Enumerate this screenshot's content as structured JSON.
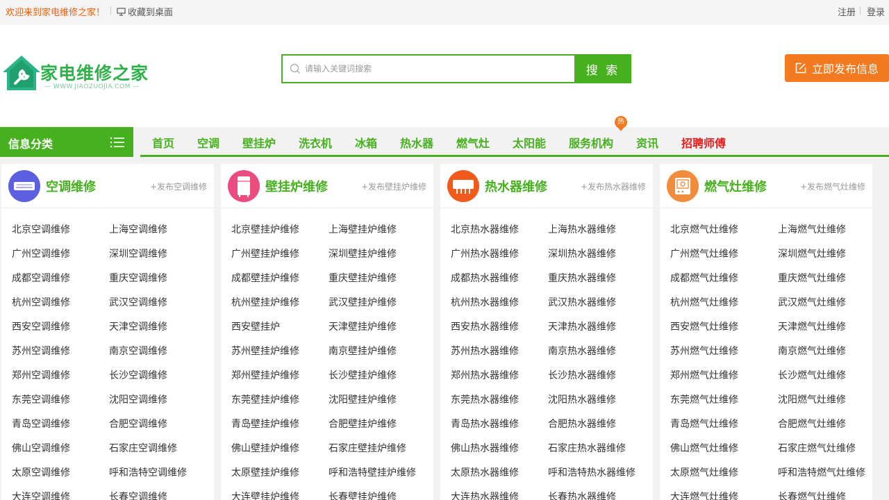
{
  "topbar": {
    "welcome": "欢迎来到家电维修之家！",
    "favorite": "收藏到桌面",
    "register": "注册",
    "login": "登录"
  },
  "logo": {
    "name": "家电维修之家",
    "url": "— WWW.JIAOZUOJIA.COM —"
  },
  "search": {
    "placeholder": "请输入关键词搜索",
    "button": "搜 索"
  },
  "publish_button": "立即发布信息",
  "nav": {
    "category_label": "信息分类",
    "hot_badge": "热",
    "items": [
      {
        "label": "首页"
      },
      {
        "label": "空调"
      },
      {
        "label": "壁挂炉"
      },
      {
        "label": "洗衣机"
      },
      {
        "label": "冰箱"
      },
      {
        "label": "热水器"
      },
      {
        "label": "燃气灶"
      },
      {
        "label": "太阳能"
      },
      {
        "label": "服务机构"
      },
      {
        "label": "资讯"
      },
      {
        "label": "招聘师傅"
      }
    ]
  },
  "cards": [
    {
      "title": "空调维修",
      "publish_link": "+发布空调维修",
      "icon": "air-conditioner-icon",
      "icon_color": "#5b5fe0",
      "links": [
        "北京空调维修",
        "上海空调维修",
        "广州空调维修",
        "深圳空调维修",
        "成都空调维修",
        "重庆空调维修",
        "杭州空调维修",
        "武汉空调维修",
        "西安空调维修",
        "天津空调维修",
        "苏州空调维修",
        "南京空调维修",
        "郑州空调维修",
        "长沙空调维修",
        "东莞空调维修",
        "沈阳空调维修",
        "青岛空调维修",
        "合肥空调维修",
        "佛山空调维修",
        "石家庄空调维修",
        "太原空调维修",
        "呼和浩特空调维修",
        "大连空调维修",
        "长春空调维修"
      ]
    },
    {
      "title": "壁挂炉维修",
      "publish_link": "+发布壁挂炉维修",
      "icon": "wall-boiler-icon",
      "icon_color": "#ea4c7e",
      "links": [
        "北京壁挂炉维修",
        "上海壁挂炉维修",
        "广州壁挂炉维修",
        "深圳壁挂炉维修",
        "成都壁挂炉维修",
        "重庆壁挂炉维修",
        "杭州壁挂炉维修",
        "武汉壁挂炉维修",
        "西安壁挂炉",
        "天津壁挂炉维修",
        "苏州壁挂炉维修",
        "南京壁挂炉维修",
        "郑州壁挂炉维修",
        "长沙壁挂炉维修",
        "东莞壁挂炉维修",
        "沈阳壁挂炉维修",
        "青岛壁挂炉维修",
        "合肥壁挂炉维修",
        "佛山壁挂炉维修",
        "石家庄壁挂炉维修",
        "太原壁挂炉维修",
        "呼和浩特壁挂炉维修",
        "大连壁挂炉维修",
        "长春壁挂炉维修"
      ]
    },
    {
      "title": "热水器维修",
      "publish_link": "+发布热水器维修",
      "icon": "water-heater-icon",
      "icon_color": "#f05a1a",
      "links": [
        "北京热水器维修",
        "上海热水器维修",
        "广州热水器维修",
        "深圳热水器维修",
        "成都热水器维修",
        "重庆热水器维修",
        "杭州热水器维修",
        "武汉热水器维修",
        "西安热水器维修",
        "天津热水器维修",
        "苏州热水器维修",
        "南京热水器维修",
        "郑州热水器维修",
        "长沙热水器维修",
        "东莞热水器维修",
        "沈阳热水器维修",
        "青岛热水器维修",
        "合肥热水器维修",
        "佛山热水器维修",
        "石家庄热水器维修",
        "太原热水器维修",
        "呼和浩特热水器维修",
        "大连热水器维修",
        "长春热水器维修"
      ]
    },
    {
      "title": "燃气灶维修",
      "publish_link": "+发布燃气灶维修",
      "icon": "gas-stove-icon",
      "icon_color": "#f08c3c",
      "links": [
        "北京燃气灶维修",
        "上海燃气灶维修",
        "广州燃气灶维修",
        "深圳燃气灶维修",
        "成都燃气灶维修",
        "重庆燃气灶维修",
        "杭州燃气灶维修",
        "武汉燃气灶维修",
        "西安燃气灶维修",
        "天津燃气灶维修",
        "苏州燃气灶维修",
        "南京燃气灶维修",
        "郑州燃气灶维修",
        "长沙燃气灶维修",
        "东莞燃气灶维修",
        "沈阳燃气灶维修",
        "青岛燃气灶维修",
        "合肥燃气灶维修",
        "佛山燃气灶维修",
        "石家庄燃气灶维修",
        "太原燃气灶维修",
        "呼和浩特燃气灶维修",
        "大连燃气灶维修",
        "长春燃气灶维修"
      ]
    }
  ]
}
